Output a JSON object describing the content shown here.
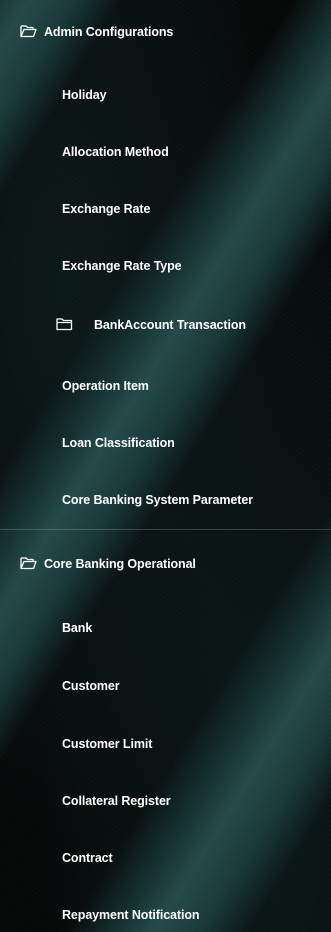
{
  "menu": {
    "admin_configurations": {
      "label": "Admin Configurations",
      "icon": "folder-open-icon",
      "items": [
        "Holiday",
        "Allocation Method",
        "Exchange Rate",
        "Exchange Rate Type"
      ],
      "subfolder": {
        "label": "BankAccount Transaction",
        "icon": "folder-closed-icon"
      },
      "items_after_subfolder": [
        "Operation Item",
        "Loan Classification",
        "Core Banking System Parameter"
      ]
    },
    "core_banking_operational": {
      "label": "Core Banking Operational",
      "icon": "folder-open-icon",
      "items": [
        "Bank",
        "Customer",
        "Customer Limit",
        "Collateral Register",
        "Contract",
        "Repayment Notification"
      ]
    }
  },
  "colors": {
    "text": "#ffffff",
    "background": "#070909",
    "stripe": "#285050"
  }
}
